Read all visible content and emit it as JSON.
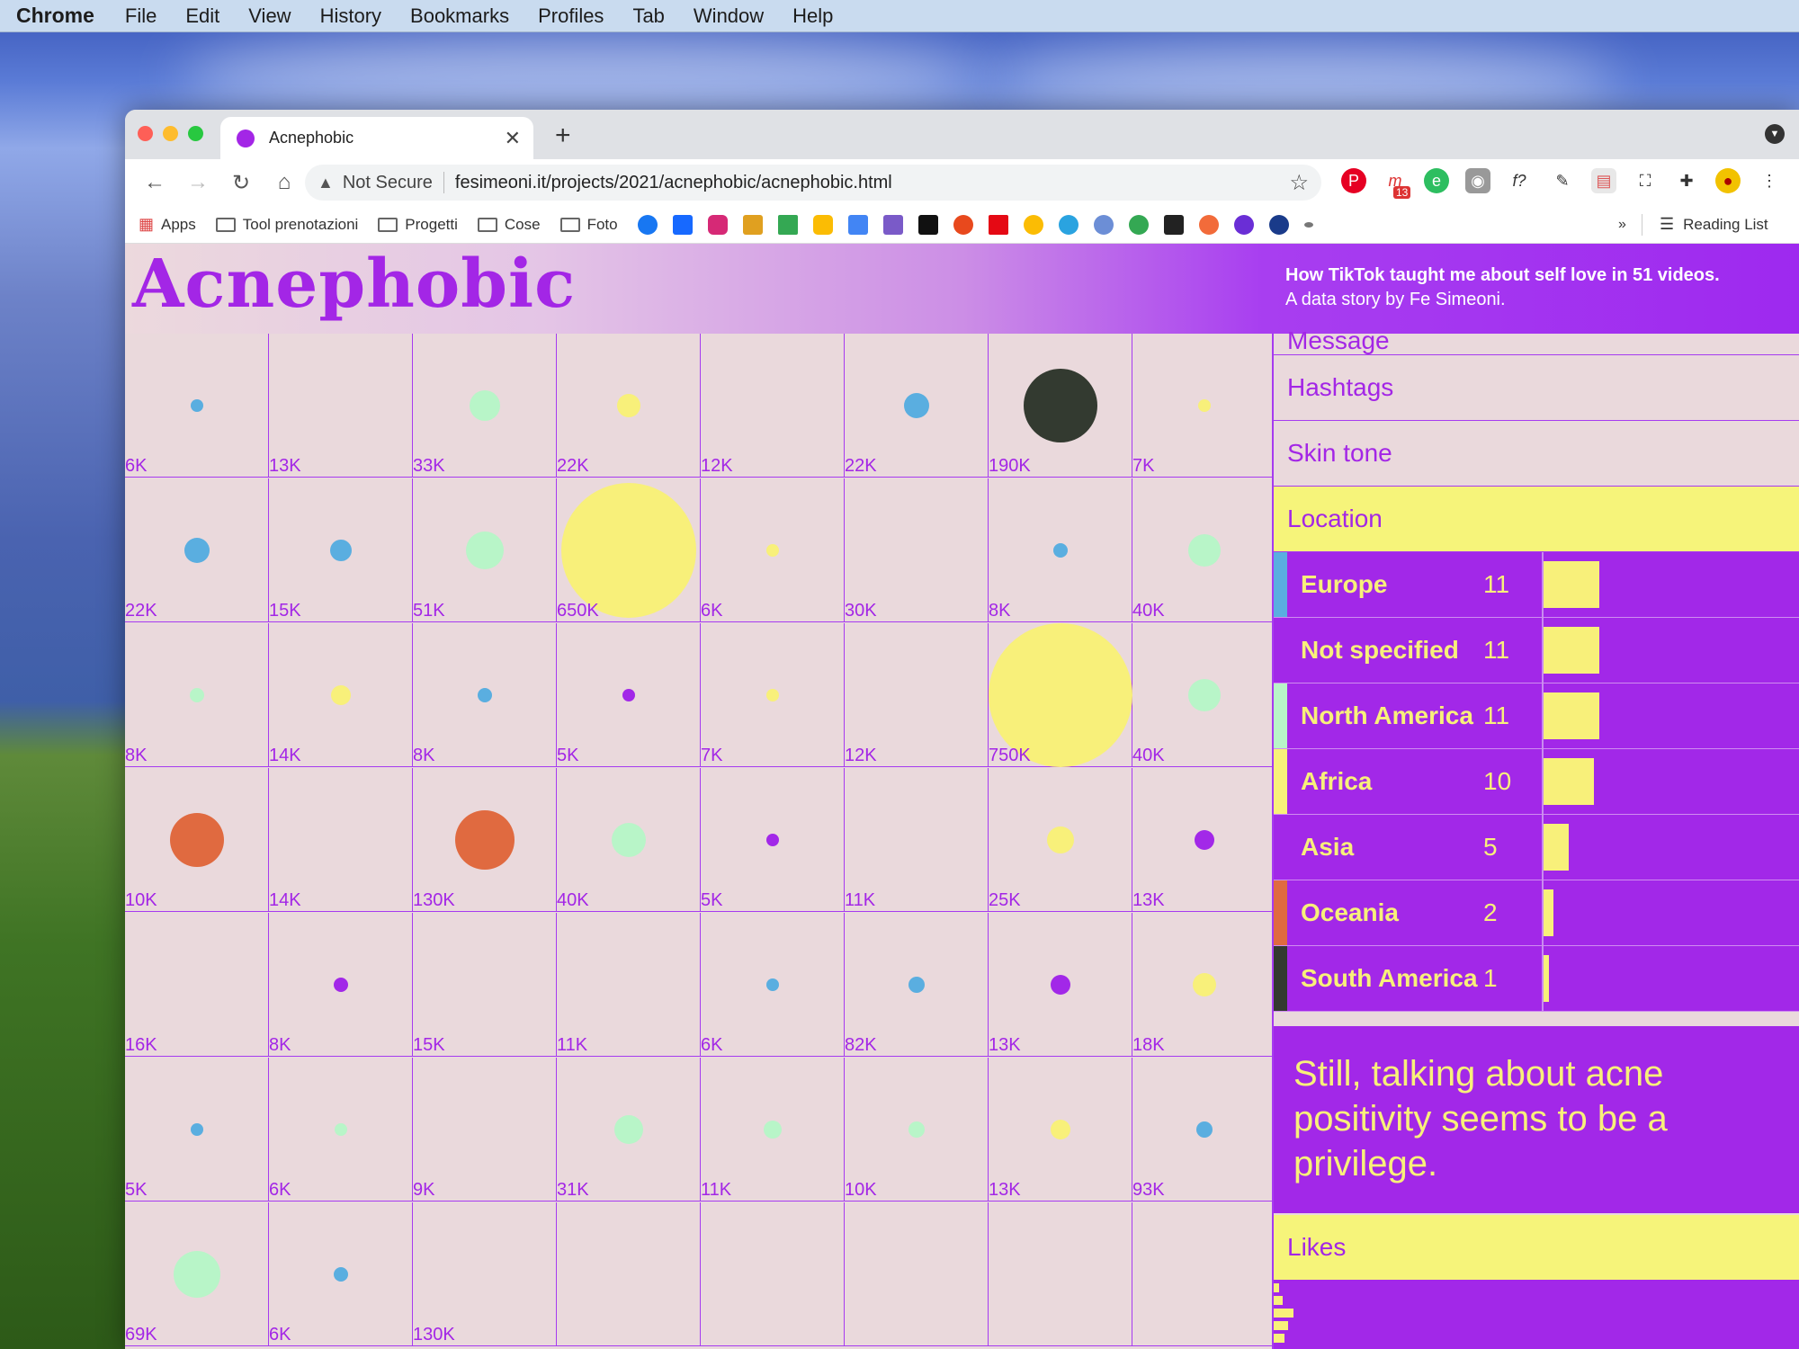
{
  "menubar": {
    "app": "Chrome",
    "items": [
      "File",
      "Edit",
      "View",
      "History",
      "Bookmarks",
      "Profiles",
      "Tab",
      "Window",
      "Help"
    ]
  },
  "tab": {
    "title": "Acnephobic"
  },
  "omnibox": {
    "security": "Not Secure",
    "url": "fesimeoni.it/projects/2021/acnephobic/acnephobic.html"
  },
  "extensions": {
    "mail_badge": "13"
  },
  "bookmarks": {
    "apps": "Apps",
    "folders": [
      "Tool prenotazioni",
      "Progetti",
      "Cose",
      "Foto"
    ],
    "overflow": "»",
    "reading_list": "Reading List"
  },
  "page": {
    "logo": "Acnephobic",
    "tagline_bold": "How TikTok taught me about self love in 51 videos.",
    "tagline": "A data story by Fe Simeoni.",
    "grid": [
      [
        "6K",
        "13K",
        "33K",
        "22K",
        "12K",
        "22K",
        "190K",
        "7K"
      ],
      [
        "22K",
        "15K",
        "51K",
        "650K",
        "6K",
        "30K",
        "8K",
        "40K"
      ],
      [
        "8K",
        "14K",
        "8K",
        "5K",
        "7K",
        "12K",
        "750K",
        "40K"
      ],
      [
        "10K",
        "14K",
        "130K",
        "40K",
        "5K",
        "11K",
        "25K",
        "13K"
      ],
      [
        "16K",
        "8K",
        "15K",
        "11K",
        "6K",
        "82K",
        "13K",
        "18K"
      ],
      [
        "5K",
        "6K",
        "9K",
        "31K",
        "11K",
        "10K",
        "13K",
        "93K"
      ],
      [
        "69K",
        "6K",
        "130K",
        "",
        "",
        "",
        "",
        ""
      ]
    ],
    "sidebar": {
      "partial_top": "Message",
      "hashtags": "Hashtags",
      "skin_tone": "Skin tone",
      "location": "Location",
      "locations": [
        {
          "name": "Europe",
          "count": "11",
          "color": "#5aaee0",
          "share": 0.1
        },
        {
          "name": "Not specified",
          "count": "11",
          "color": "#a228e8",
          "share": 0.1
        },
        {
          "name": "North America",
          "count": "11",
          "color": "#b8f5c8",
          "share": 0.1
        },
        {
          "name": "Africa",
          "count": "10",
          "color": "#f8f07a",
          "share": 0.091
        },
        {
          "name": "Asia",
          "count": "5",
          "color": "#a228e8",
          "share": 0.045
        },
        {
          "name": "Oceania",
          "count": "2",
          "color": "#e06a40",
          "share": 0.018
        },
        {
          "name": "South America",
          "count": "1",
          "color": "#333a30",
          "share": 0.009
        }
      ],
      "quote": "Still, talking about acne positivity seems to be a privilege.",
      "likes": "Likes"
    }
  }
}
